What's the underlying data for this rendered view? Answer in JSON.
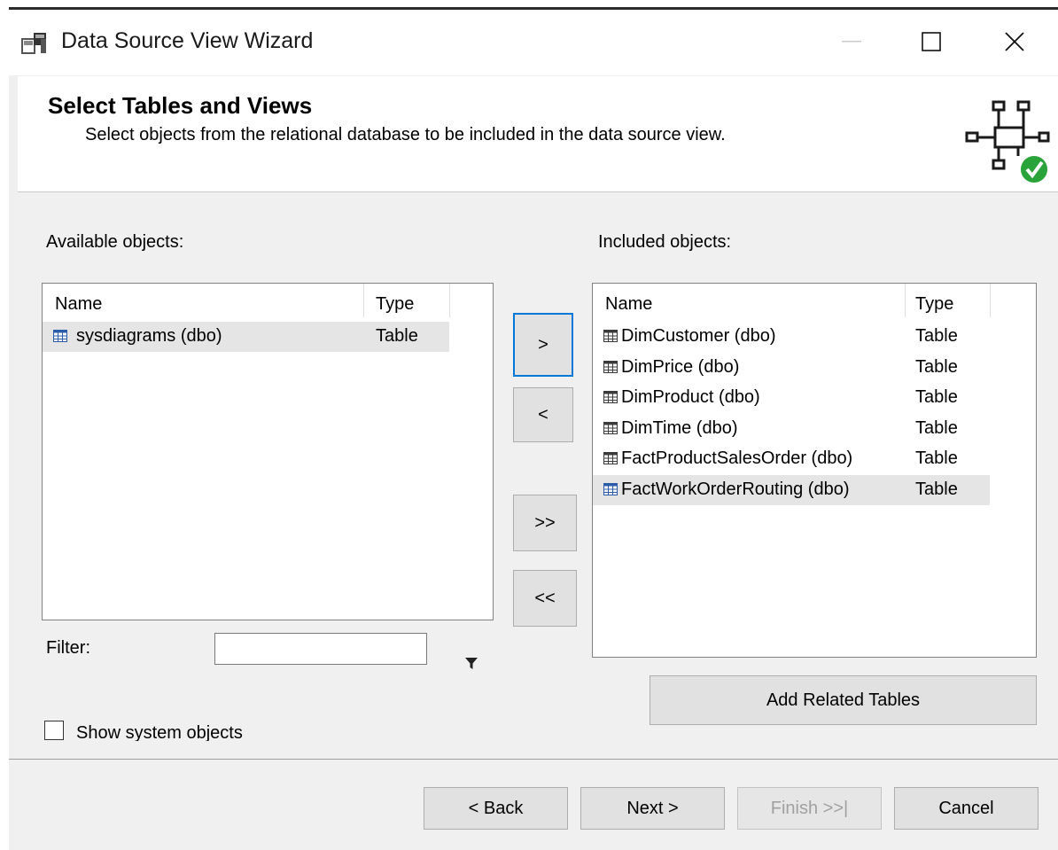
{
  "window": {
    "title": "Data Source View Wizard",
    "minimize_icon": "minimize-icon",
    "maximize_icon": "maximize-icon",
    "close_icon": "close-icon"
  },
  "header": {
    "title": "Select Tables and Views",
    "subtitle": "Select objects from the relational database to be included in the data source view.",
    "icon": "data-source-view-check-icon",
    "check_color": "#2aa33a"
  },
  "available": {
    "label": "Available objects:",
    "columns": [
      "Name",
      "Type"
    ],
    "rows": [
      {
        "name": "sysdiagrams (dbo)",
        "type": "Table",
        "selected": true
      }
    ]
  },
  "included": {
    "label": "Included objects:",
    "columns": [
      "Name",
      "Type"
    ],
    "rows": [
      {
        "name": "DimCustomer (dbo)",
        "type": "Table",
        "selected": false
      },
      {
        "name": "DimPrice (dbo)",
        "type": "Table",
        "selected": false
      },
      {
        "name": "DimProduct (dbo)",
        "type": "Table",
        "selected": false
      },
      {
        "name": "DimTime (dbo)",
        "type": "Table",
        "selected": false
      },
      {
        "name": "FactProductSalesOrder (dbo)",
        "type": "Table",
        "selected": false
      },
      {
        "name": "FactWorkOrderRouting (dbo)",
        "type": "Table",
        "selected": true
      }
    ]
  },
  "move_buttons": {
    "add": ">",
    "remove": "<",
    "add_all": ">>",
    "remove_all": "<<"
  },
  "filter": {
    "label": "Filter:",
    "value": "",
    "icon": "funnel-icon"
  },
  "add_related_label": "Add Related Tables",
  "show_system_objects": {
    "label": "Show system objects",
    "checked": false
  },
  "footer": {
    "back": "< Back",
    "next": "Next >",
    "finish": "Finish >>|",
    "cancel": "Cancel"
  },
  "colors": {
    "accent": "#0078d7",
    "grid_icon": "#3a3a3a",
    "grid_icon_selected": "#2a5caa"
  }
}
